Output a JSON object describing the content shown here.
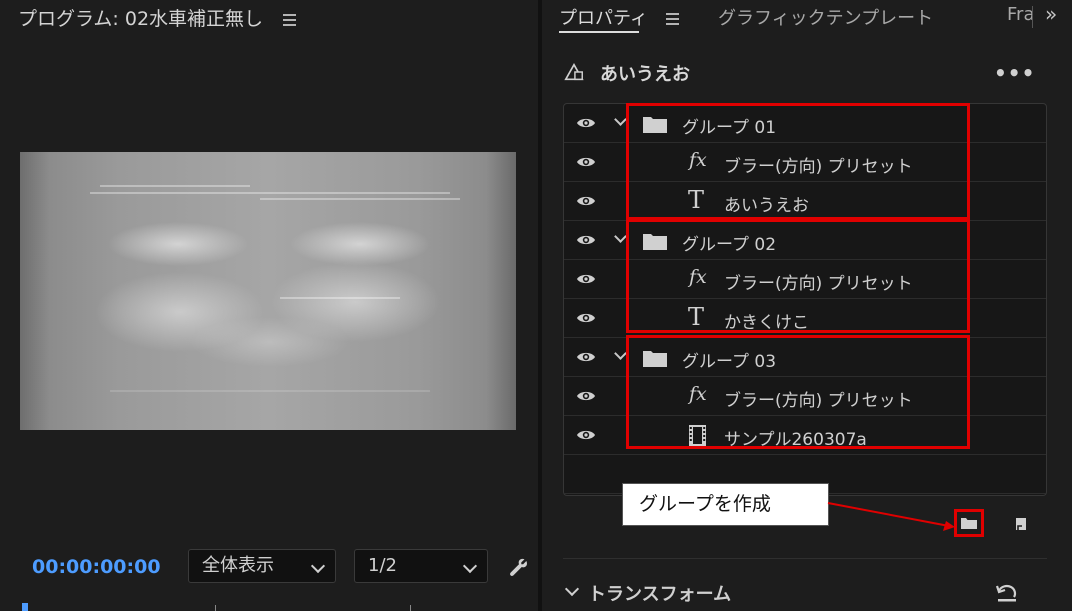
{
  "program": {
    "title": "プログラム: 02水車補正無し",
    "timecode": "00:00:00:00",
    "zoom_select": "全体表示",
    "resolution_select": "1/2"
  },
  "properties": {
    "tabs": [
      {
        "label": "プロパティ"
      },
      {
        "label": "グラフィックテンプレート"
      },
      {
        "label": "Fra"
      }
    ],
    "clip_title": "あいうえお",
    "more_label": "•••",
    "layers": [
      {
        "label": "グループ 01",
        "icon": "folder-icon",
        "type": "group"
      },
      {
        "label": "ブラー(方向)  プリセット",
        "icon": "fx-icon",
        "type": "effect"
      },
      {
        "label": "あいうえお",
        "icon": "text-icon",
        "type": "text"
      },
      {
        "label": "グループ 02",
        "icon": "folder-icon",
        "type": "group"
      },
      {
        "label": "ブラー(方向)  プリセット",
        "icon": "fx-icon",
        "type": "effect"
      },
      {
        "label": "かきくけこ",
        "icon": "text-icon",
        "type": "text"
      },
      {
        "label": "グループ 03",
        "icon": "folder-icon",
        "type": "group"
      },
      {
        "label": "ブラー(方向)  プリセット",
        "icon": "fx-icon",
        "type": "effect"
      },
      {
        "label": "サンプル260307a",
        "icon": "film-icon",
        "type": "clip"
      }
    ],
    "section_title": "トランスフォーム"
  },
  "annotation": {
    "callout": "グループを作成",
    "highlight_color": "#e00000"
  },
  "colors": {
    "accent": "#4d9cff",
    "panel_bg": "#1d1d1d"
  }
}
